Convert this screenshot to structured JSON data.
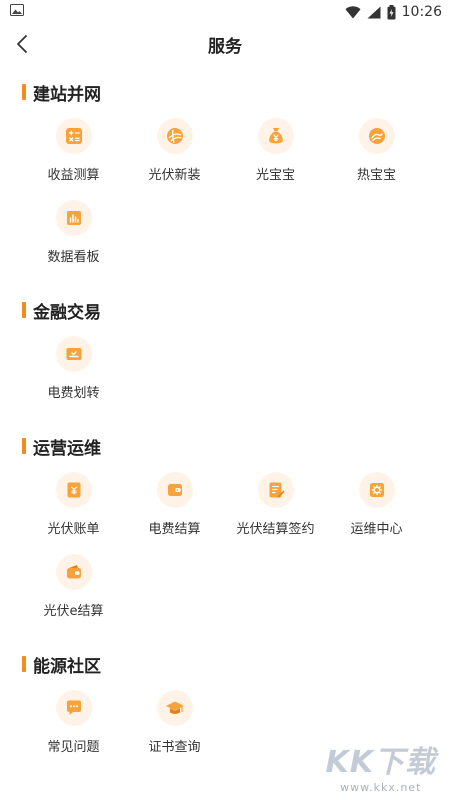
{
  "status_bar": {
    "time": "10:26"
  },
  "header": {
    "title": "服务"
  },
  "sections": [
    {
      "title": "建站并网",
      "items": [
        {
          "label": "收益测算",
          "icon": "calculator-icon"
        },
        {
          "label": "光伏新装",
          "icon": "solar-panel-icon"
        },
        {
          "label": "光宝宝",
          "icon": "money-bag-icon"
        },
        {
          "label": "热宝宝",
          "icon": "heat-icon"
        },
        {
          "label": "数据看板",
          "icon": "dashboard-icon"
        }
      ]
    },
    {
      "title": "金融交易",
      "items": [
        {
          "label": "电费划转",
          "icon": "transfer-icon"
        }
      ]
    },
    {
      "title": "运营运维",
      "items": [
        {
          "label": "光伏账单",
          "icon": "bill-icon"
        },
        {
          "label": "电费结算",
          "icon": "wallet-icon"
        },
        {
          "label": "光伏结算签约",
          "icon": "contract-icon"
        },
        {
          "label": "运维中心",
          "icon": "gear-icon"
        },
        {
          "label": "光伏e结算",
          "icon": "purse-icon"
        }
      ]
    },
    {
      "title": "能源社区",
      "items": [
        {
          "label": "常见问题",
          "icon": "chat-icon"
        },
        {
          "label": "证书查询",
          "icon": "graduation-cap-icon"
        }
      ]
    }
  ],
  "watermark": {
    "main": "KK下载",
    "sub": "www.kkx.net"
  },
  "colors": {
    "accent": "#f58a1f",
    "icon_bg": "#fff3e8"
  }
}
